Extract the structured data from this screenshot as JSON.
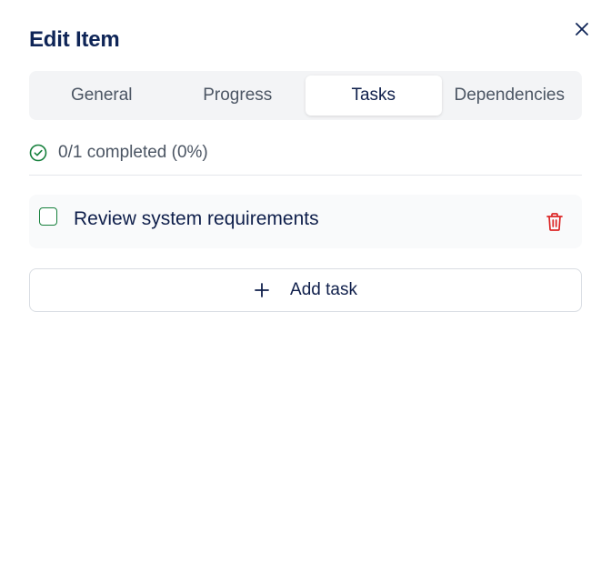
{
  "dialog": {
    "title": "Edit Item",
    "close_icon": "close-icon"
  },
  "tabs": [
    {
      "label": "General",
      "active": false
    },
    {
      "label": "Progress",
      "active": false
    },
    {
      "label": "Tasks",
      "active": true
    },
    {
      "label": "Dependencies",
      "active": false
    }
  ],
  "progress": {
    "icon": "check-circle-icon",
    "text": "0/1 completed (0%)",
    "completed": 0,
    "total": 1,
    "percent": 0
  },
  "tasks": [
    {
      "label": "Review system requirements",
      "checked": false,
      "delete_icon": "trash-icon"
    }
  ],
  "add_task": {
    "icon": "plus-icon",
    "label": "Add task"
  },
  "colors": {
    "title": "#0f2557",
    "text_muted": "#4b5563",
    "success": "#16803c",
    "danger": "#dc2626",
    "tab_bg": "#f3f4f6",
    "task_bg": "#f9fafb"
  }
}
